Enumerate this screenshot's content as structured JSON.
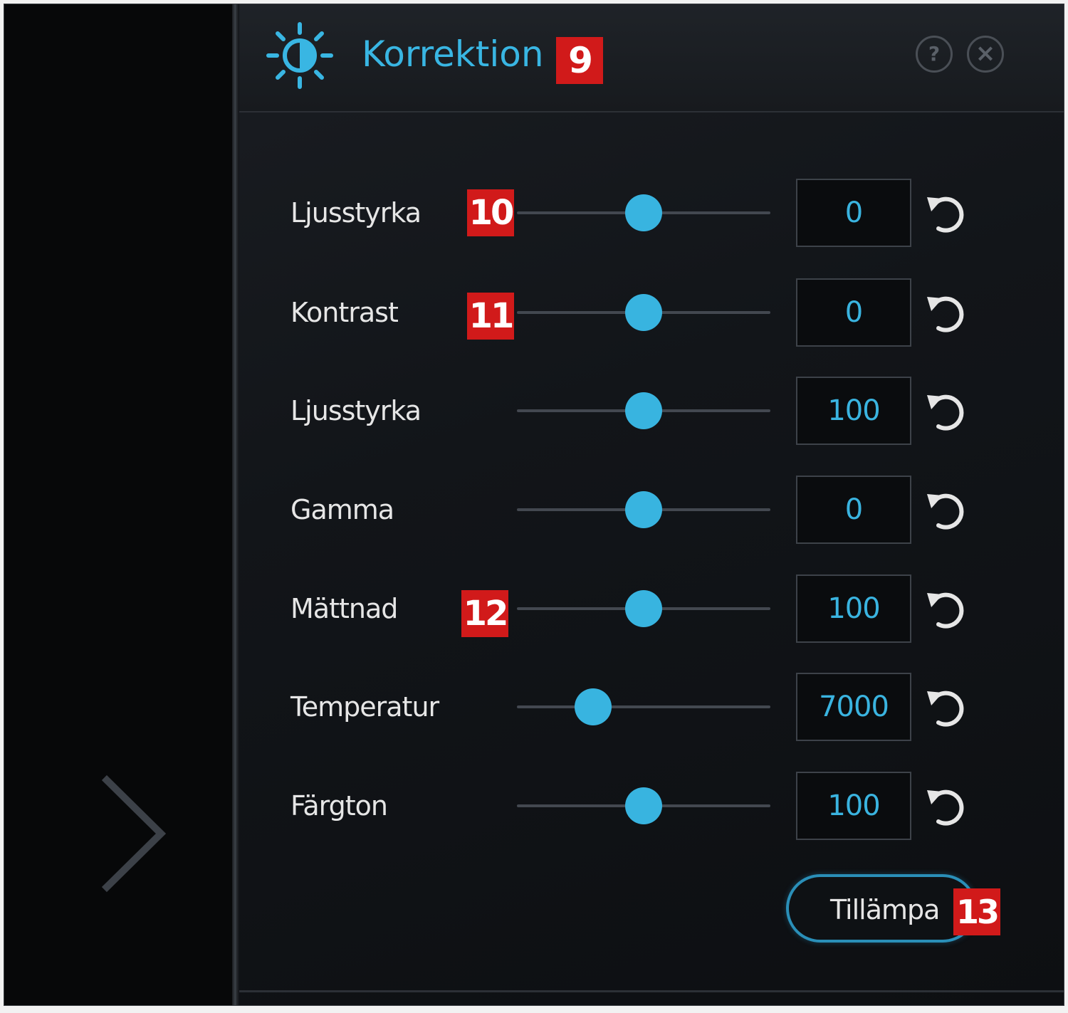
{
  "header": {
    "title": "Korrektion",
    "title_badge": "9",
    "help_label": "?",
    "close_label": "×"
  },
  "colors": {
    "accent": "#38b4e0",
    "badge": "#d11a1a",
    "label": "#e6e6e6",
    "background": "#0d0f12"
  },
  "rows": [
    {
      "label": "Ljusstyrka",
      "badge": "10",
      "value": "0",
      "slider_position": 0.5
    },
    {
      "label": "Kontrast",
      "badge": "11",
      "value": "0",
      "slider_position": 0.5
    },
    {
      "label": "Ljusstyrka",
      "badge": "",
      "value": "100",
      "slider_position": 0.5
    },
    {
      "label": "Gamma",
      "badge": "",
      "value": "0",
      "slider_position": 0.5
    },
    {
      "label": "Mättnad",
      "badge": "12",
      "value": "100",
      "slider_position": 0.5
    },
    {
      "label": "Temperatur",
      "badge": "",
      "value": "7000",
      "slider_position": 0.3
    },
    {
      "label": "Färgton",
      "badge": "",
      "value": "100",
      "slider_position": 0.5
    }
  ],
  "apply": {
    "label": "Tillämpa",
    "badge": "13"
  },
  "icons": {
    "header": "sun-icon",
    "reset": "reset-icon",
    "expand": "chevron-right-icon"
  }
}
